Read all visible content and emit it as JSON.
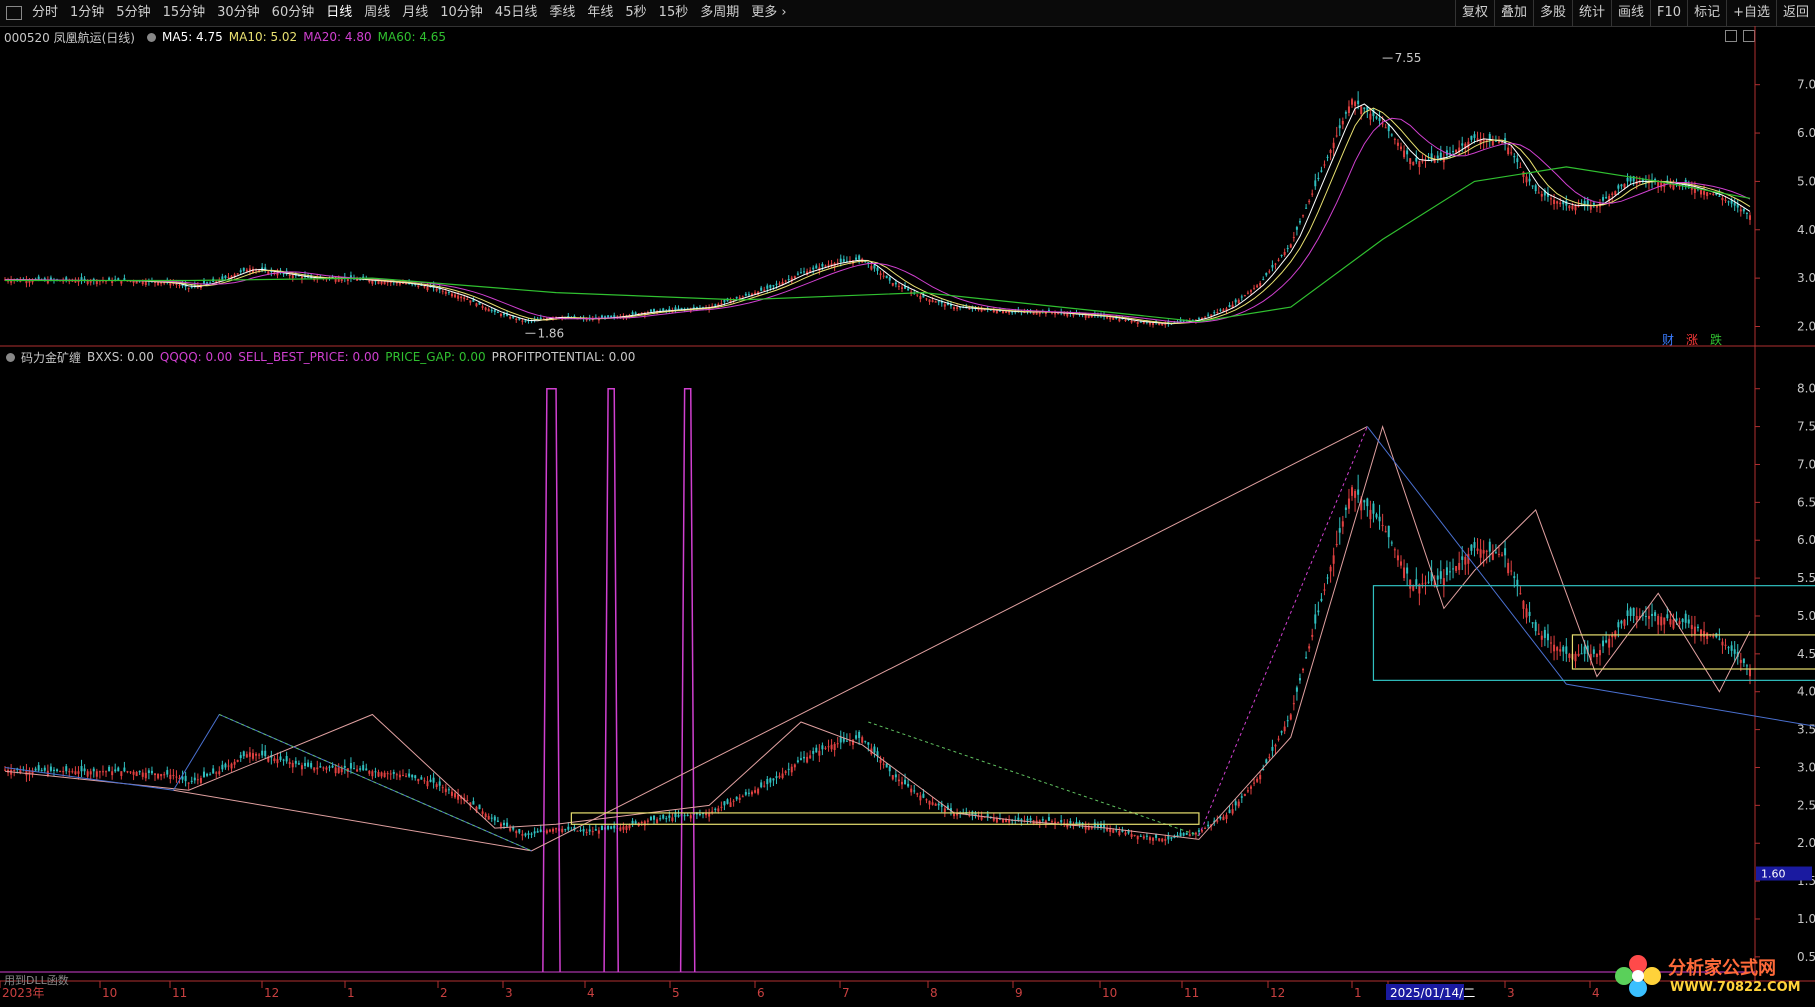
{
  "toolbar": {
    "tabs": [
      "分时",
      "1分钟",
      "5分钟",
      "15分钟",
      "30分钟",
      "60分钟",
      "日线",
      "周线",
      "月线",
      "10分钟",
      "45日线",
      "季线",
      "年线",
      "5秒",
      "15秒",
      "多周期",
      "更多"
    ],
    "active_tab": "日线",
    "right_tools": [
      "复权",
      "叠加",
      "多股",
      "统计",
      "画线",
      "F10",
      "标记",
      "+自选",
      "返回"
    ]
  },
  "main_info": {
    "stock": "000520 凤凰航运(日线)",
    "ma5": "MA5: 4.75",
    "ma10": "MA10: 5.02",
    "ma20": "MA20: 4.80",
    "ma60": "MA60: 4.65"
  },
  "indicator_info": {
    "name": "码力金矿缠",
    "bxxs": "BXXS: 0.00",
    "qqqq": "QQQQ: 0.00",
    "sell": "SELL_BEST_PRICE: 0.00",
    "gap": "PRICE_GAP: 0.00",
    "profit": "PROFITPOTENTIAL: 0.00"
  },
  "main_annotations": {
    "high": "7.55",
    "low": "1.86"
  },
  "price_tag": "1.60",
  "main_axis": [
    "7.00",
    "6.00",
    "5.00",
    "4.00",
    "3.00",
    "2.00"
  ],
  "ind_axis": [
    "8.00",
    "7.50",
    "7.00",
    "6.50",
    "6.00",
    "5.50",
    "5.00",
    "4.50",
    "4.00",
    "3.50",
    "3.00",
    "2.50",
    "2.00",
    "1.50",
    "1.00",
    "0.50"
  ],
  "tags": {
    "cai": "财",
    "zhang": "涨",
    "die": "跌"
  },
  "date_axis": [
    "2023年",
    "10",
    "11",
    "12",
    "1",
    "2",
    "3",
    "4",
    "5",
    "6",
    "7",
    "8",
    "9",
    "10",
    "11",
    "12",
    "1",
    "2025/01/14/二",
    "3",
    "4"
  ],
  "footer_note": "用到DLL函数",
  "logo": {
    "title": "分析家公式网",
    "url": "WWW.70822.COM"
  },
  "colors": {
    "ma5": "#ffffff",
    "ma10": "#e8e070",
    "ma20": "#d040d0",
    "ma60": "#30c030",
    "up": "#e04040",
    "down": "#30c0c0",
    "bxxs": "#c8c8c8",
    "qqqq": "#d040d0",
    "sell": "#d040d0",
    "gap": "#30c030",
    "profit": "#c8c8c8"
  },
  "chart_data": [
    {
      "type": "line",
      "title": "000520 凤凰航运(日线)",
      "ylim": [
        1.7,
        7.8
      ],
      "series": [
        {
          "name": "Close",
          "x": [
            0,
            20,
            40,
            55,
            60,
            70,
            80,
            90,
            100,
            110,
            120,
            130,
            140,
            150,
            160,
            170,
            180,
            190,
            200,
            210,
            220,
            230,
            240,
            250,
            260,
            270,
            280,
            290,
            300,
            310,
            320,
            330,
            340,
            350,
            360,
            370,
            380,
            390,
            400,
            410,
            420,
            430,
            440,
            450,
            460,
            470,
            480,
            490,
            500,
            510,
            520,
            530,
            540,
            550,
            560,
            570
          ],
          "y": [
            2.97,
            2.95,
            2.95,
            2.9,
            2.8,
            2.95,
            3.2,
            3.1,
            3.0,
            3.0,
            2.95,
            2.9,
            2.8,
            2.6,
            2.3,
            2.1,
            2.2,
            2.15,
            2.2,
            2.3,
            2.35,
            2.4,
            2.6,
            2.8,
            3.1,
            3.3,
            3.4,
            2.9,
            2.6,
            2.4,
            2.35,
            2.3,
            2.3,
            2.25,
            2.2,
            2.1,
            2.05,
            2.15,
            2.4,
            2.9,
            3.7,
            5.2,
            6.7,
            6.2,
            5.4,
            5.5,
            5.9,
            5.8,
            4.8,
            4.5,
            4.5,
            5.0,
            5.0,
            4.9,
            4.7,
            4.3
          ]
        },
        {
          "name": "MA60",
          "x": [
            0,
            60,
            120,
            180,
            240,
            300,
            360,
            390,
            420,
            450,
            480,
            510,
            540,
            570
          ],
          "y": [
            2.95,
            2.95,
            3.0,
            2.7,
            2.55,
            2.7,
            2.3,
            2.1,
            2.4,
            3.8,
            5.0,
            5.3,
            5.0,
            4.65
          ]
        }
      ]
    },
    {
      "type": "line",
      "title": "码力金矿缠",
      "ylim": [
        0.3,
        8.3
      ],
      "series": [
        {
          "name": "BXXS",
          "x": [
            0,
            60,
            120,
            160,
            180,
            190,
            230,
            260,
            280,
            310,
            330,
            360,
            390,
            420,
            450,
            470,
            480,
            500,
            520,
            540,
            560,
            570
          ],
          "y": [
            2.95,
            2.7,
            3.7,
            2.2,
            2.25,
            2.3,
            2.5,
            3.6,
            3.3,
            2.4,
            2.3,
            2.2,
            2.05,
            3.4,
            7.5,
            5.1,
            5.6,
            6.4,
            4.2,
            5.3,
            4.0,
            4.8
          ]
        }
      ]
    }
  ]
}
